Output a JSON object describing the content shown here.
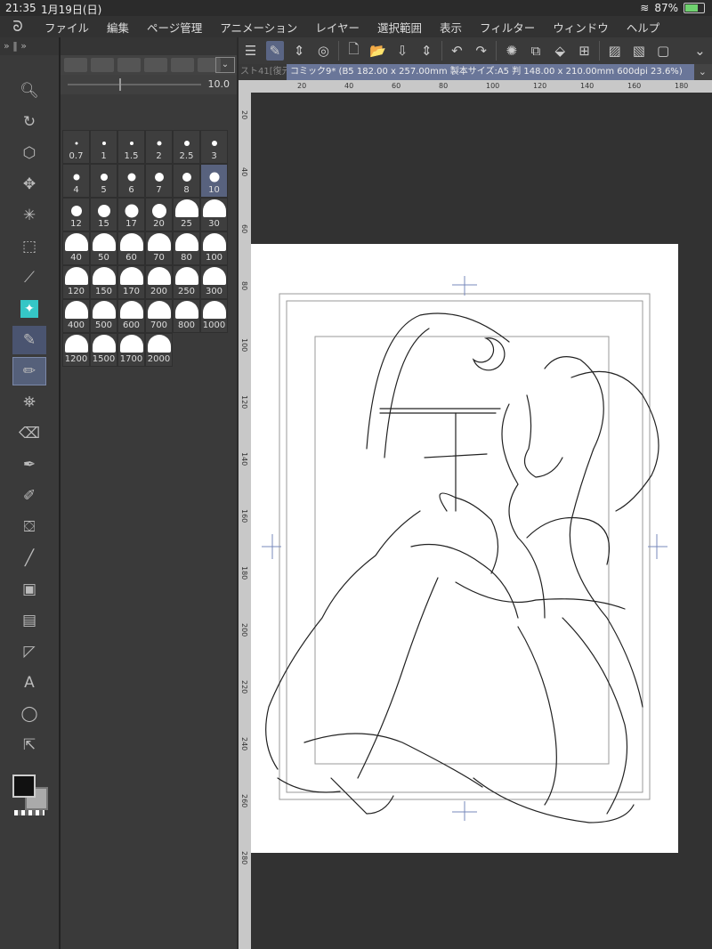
{
  "status": {
    "time": "21:35",
    "date": "1月19日(日)",
    "battery": "87%",
    "battery_level": 0.87
  },
  "menu": [
    "ファイル",
    "編集",
    "ページ管理",
    "アニメーション",
    "レイヤー",
    "選択範囲",
    "表示",
    "フィルター",
    "ウィンドウ",
    "ヘルプ"
  ],
  "brush": {
    "size_value": "10.0"
  },
  "brush_sizes": [
    "0.7",
    "1",
    "1.5",
    "2",
    "2.5",
    "3",
    "4",
    "5",
    "6",
    "7",
    "8",
    "10",
    "12",
    "15",
    "17",
    "20",
    "25",
    "30",
    "40",
    "50",
    "60",
    "70",
    "80",
    "100",
    "120",
    "150",
    "170",
    "200",
    "250",
    "300",
    "400",
    "500",
    "600",
    "700",
    "800",
    "1000",
    "1200",
    "1500",
    "1700",
    "2000"
  ],
  "selected_size": "10",
  "doc": {
    "prev_tab": "スト41[復元",
    "title": "コミック9* (B5 182.00 x 257.00mm 製本サイズ:A5 判 148.00 x 210.00mm 600dpi 23.6%)"
  },
  "ruler": {
    "h": [
      "20",
      "40",
      "60",
      "80",
      "100",
      "120",
      "140",
      "160",
      "180"
    ],
    "v": [
      "20",
      "40",
      "60",
      "80",
      "100",
      "120",
      "140",
      "160",
      "180",
      "200",
      "220",
      "240",
      "260",
      "280"
    ]
  }
}
